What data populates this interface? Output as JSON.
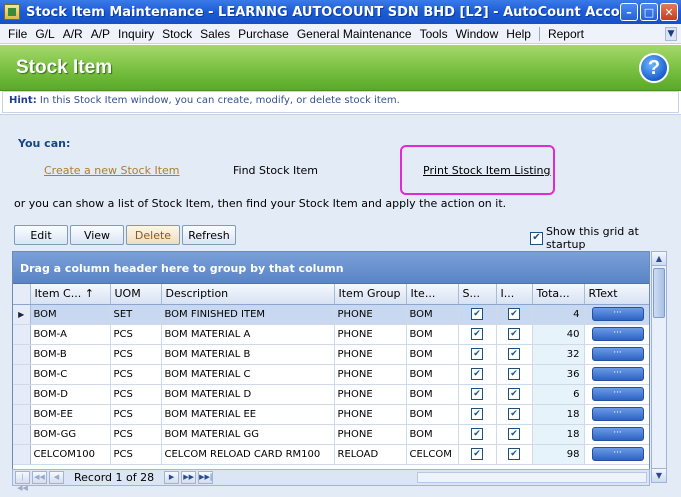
{
  "window": {
    "title": "Stock Item Maintenance - LEARNNG AUTOCOUNT SDN BHD [L2] - AutoCount Accounting (Ver:",
    "minimize": "–",
    "maximize": "□",
    "close": "✕"
  },
  "menu": [
    "File",
    "G/L",
    "A/R",
    "A/P",
    "Inquiry",
    "Stock",
    "Sales",
    "Purchase",
    "General Maintenance",
    "Tools",
    "Window",
    "Help",
    "Report"
  ],
  "header": {
    "title": "Stock Item",
    "help": "?"
  },
  "hint": {
    "label": "Hint:",
    "text": "In this Stock Item window, you can create, modify, or delete stock item."
  },
  "actions": {
    "you_can": "You can:",
    "create": "Create a new Stock Item",
    "find": "Find Stock Item",
    "print": "Print Stock Item Listing",
    "or_text": "or you can show a list of Stock Item, then find your Stock Item and apply the action on it."
  },
  "toolbar": {
    "edit": "Edit",
    "view": "View",
    "delete": "Delete",
    "refresh": "Refresh"
  },
  "show_grid": {
    "label": "Show this grid at startup",
    "checked": true
  },
  "grid": {
    "group_hint": "Drag a column header here to group by that column",
    "columns": [
      "Item C... ↑",
      "UOM",
      "Description",
      "Item Group",
      "Ite...",
      "S...",
      "I...",
      "Tota...",
      "RText"
    ],
    "rows": [
      {
        "code": "BOM",
        "uom": "SET",
        "desc": "BOM FINISHED ITEM",
        "group": "PHONE",
        "type": "BOM",
        "total": "4",
        "current": true
      },
      {
        "code": "BOM-A",
        "uom": "PCS",
        "desc": "BOM MATERIAL A",
        "group": "PHONE",
        "type": "BOM",
        "total": "40"
      },
      {
        "code": "BOM-B",
        "uom": "PCS",
        "desc": "BOM MATERIAL B",
        "group": "PHONE",
        "type": "BOM",
        "total": "32"
      },
      {
        "code": "BOM-C",
        "uom": "PCS",
        "desc": "BOM MATERIAL C",
        "group": "PHONE",
        "type": "BOM",
        "total": "36"
      },
      {
        "code": "BOM-D",
        "uom": "PCS",
        "desc": "BOM MATERIAL D",
        "group": "PHONE",
        "type": "BOM",
        "total": "6"
      },
      {
        "code": "BOM-EE",
        "uom": "PCS",
        "desc": "BOM MATERIAL EE",
        "group": "PHONE",
        "type": "BOM",
        "total": "18"
      },
      {
        "code": "BOM-GG",
        "uom": "PCS",
        "desc": "BOM MATERIAL GG",
        "group": "PHONE",
        "type": "BOM",
        "total": "18"
      },
      {
        "code": "CELCOM100",
        "uom": "PCS",
        "desc": "CELCOM RELOAD CARD RM100",
        "group": "RELOAD",
        "type": "CELCOM",
        "total": "98"
      }
    ],
    "rtext_btn": "···",
    "record": "Record 1 of 28"
  }
}
